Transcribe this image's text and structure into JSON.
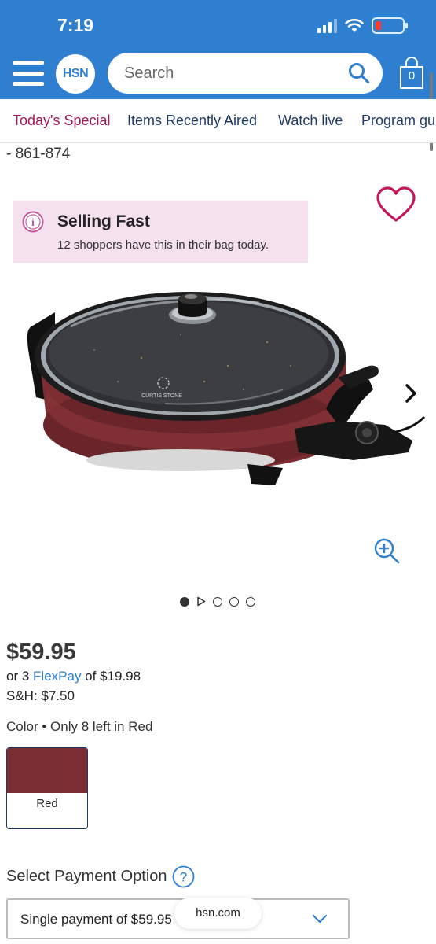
{
  "status": {
    "time": "7:19",
    "battery_color": "#ff3b30"
  },
  "header": {
    "logo_text": "HSN",
    "search_placeholder": "Search",
    "cart_count": "0",
    "brand_color": "#2f7fd1"
  },
  "nav": {
    "items": [
      {
        "label": "Today's Special",
        "active": true
      },
      {
        "label": "Items Recently Aired",
        "active": false
      },
      {
        "label": "Watch live",
        "active": false
      },
      {
        "label": "Program gu",
        "active": false
      }
    ],
    "active_color": "#a3155a"
  },
  "product": {
    "item_number_fragment": "- 861-874",
    "selling_fast": {
      "title": "Selling Fast",
      "subtitle": "12 shoppers have this in their bag today."
    },
    "image_brand_text": "CURTIS STONE",
    "carousel": {
      "slide_count": 5,
      "active_index": 0
    },
    "price": "$59.95",
    "flexpay": {
      "prefix": "or 3 ",
      "link": "FlexPay",
      "suffix": " of $19.98"
    },
    "shipping": "S&H: $7.50",
    "color_label": "Color • Only 8 left in Red",
    "color_options": [
      {
        "name": "Red",
        "swatch": "#7a2e33",
        "selected": true
      }
    ],
    "payment": {
      "label": "Select Payment Option",
      "selected": "Single payment of $59.95"
    }
  },
  "browser": {
    "url": "hsn.com"
  },
  "icons": [
    "hamburger-icon",
    "search-icon",
    "shopping-bag-icon",
    "heart-icon",
    "info-icon",
    "chevron-right-icon",
    "zoom-in-icon",
    "play-icon",
    "help-icon",
    "chevron-down-icon"
  ]
}
